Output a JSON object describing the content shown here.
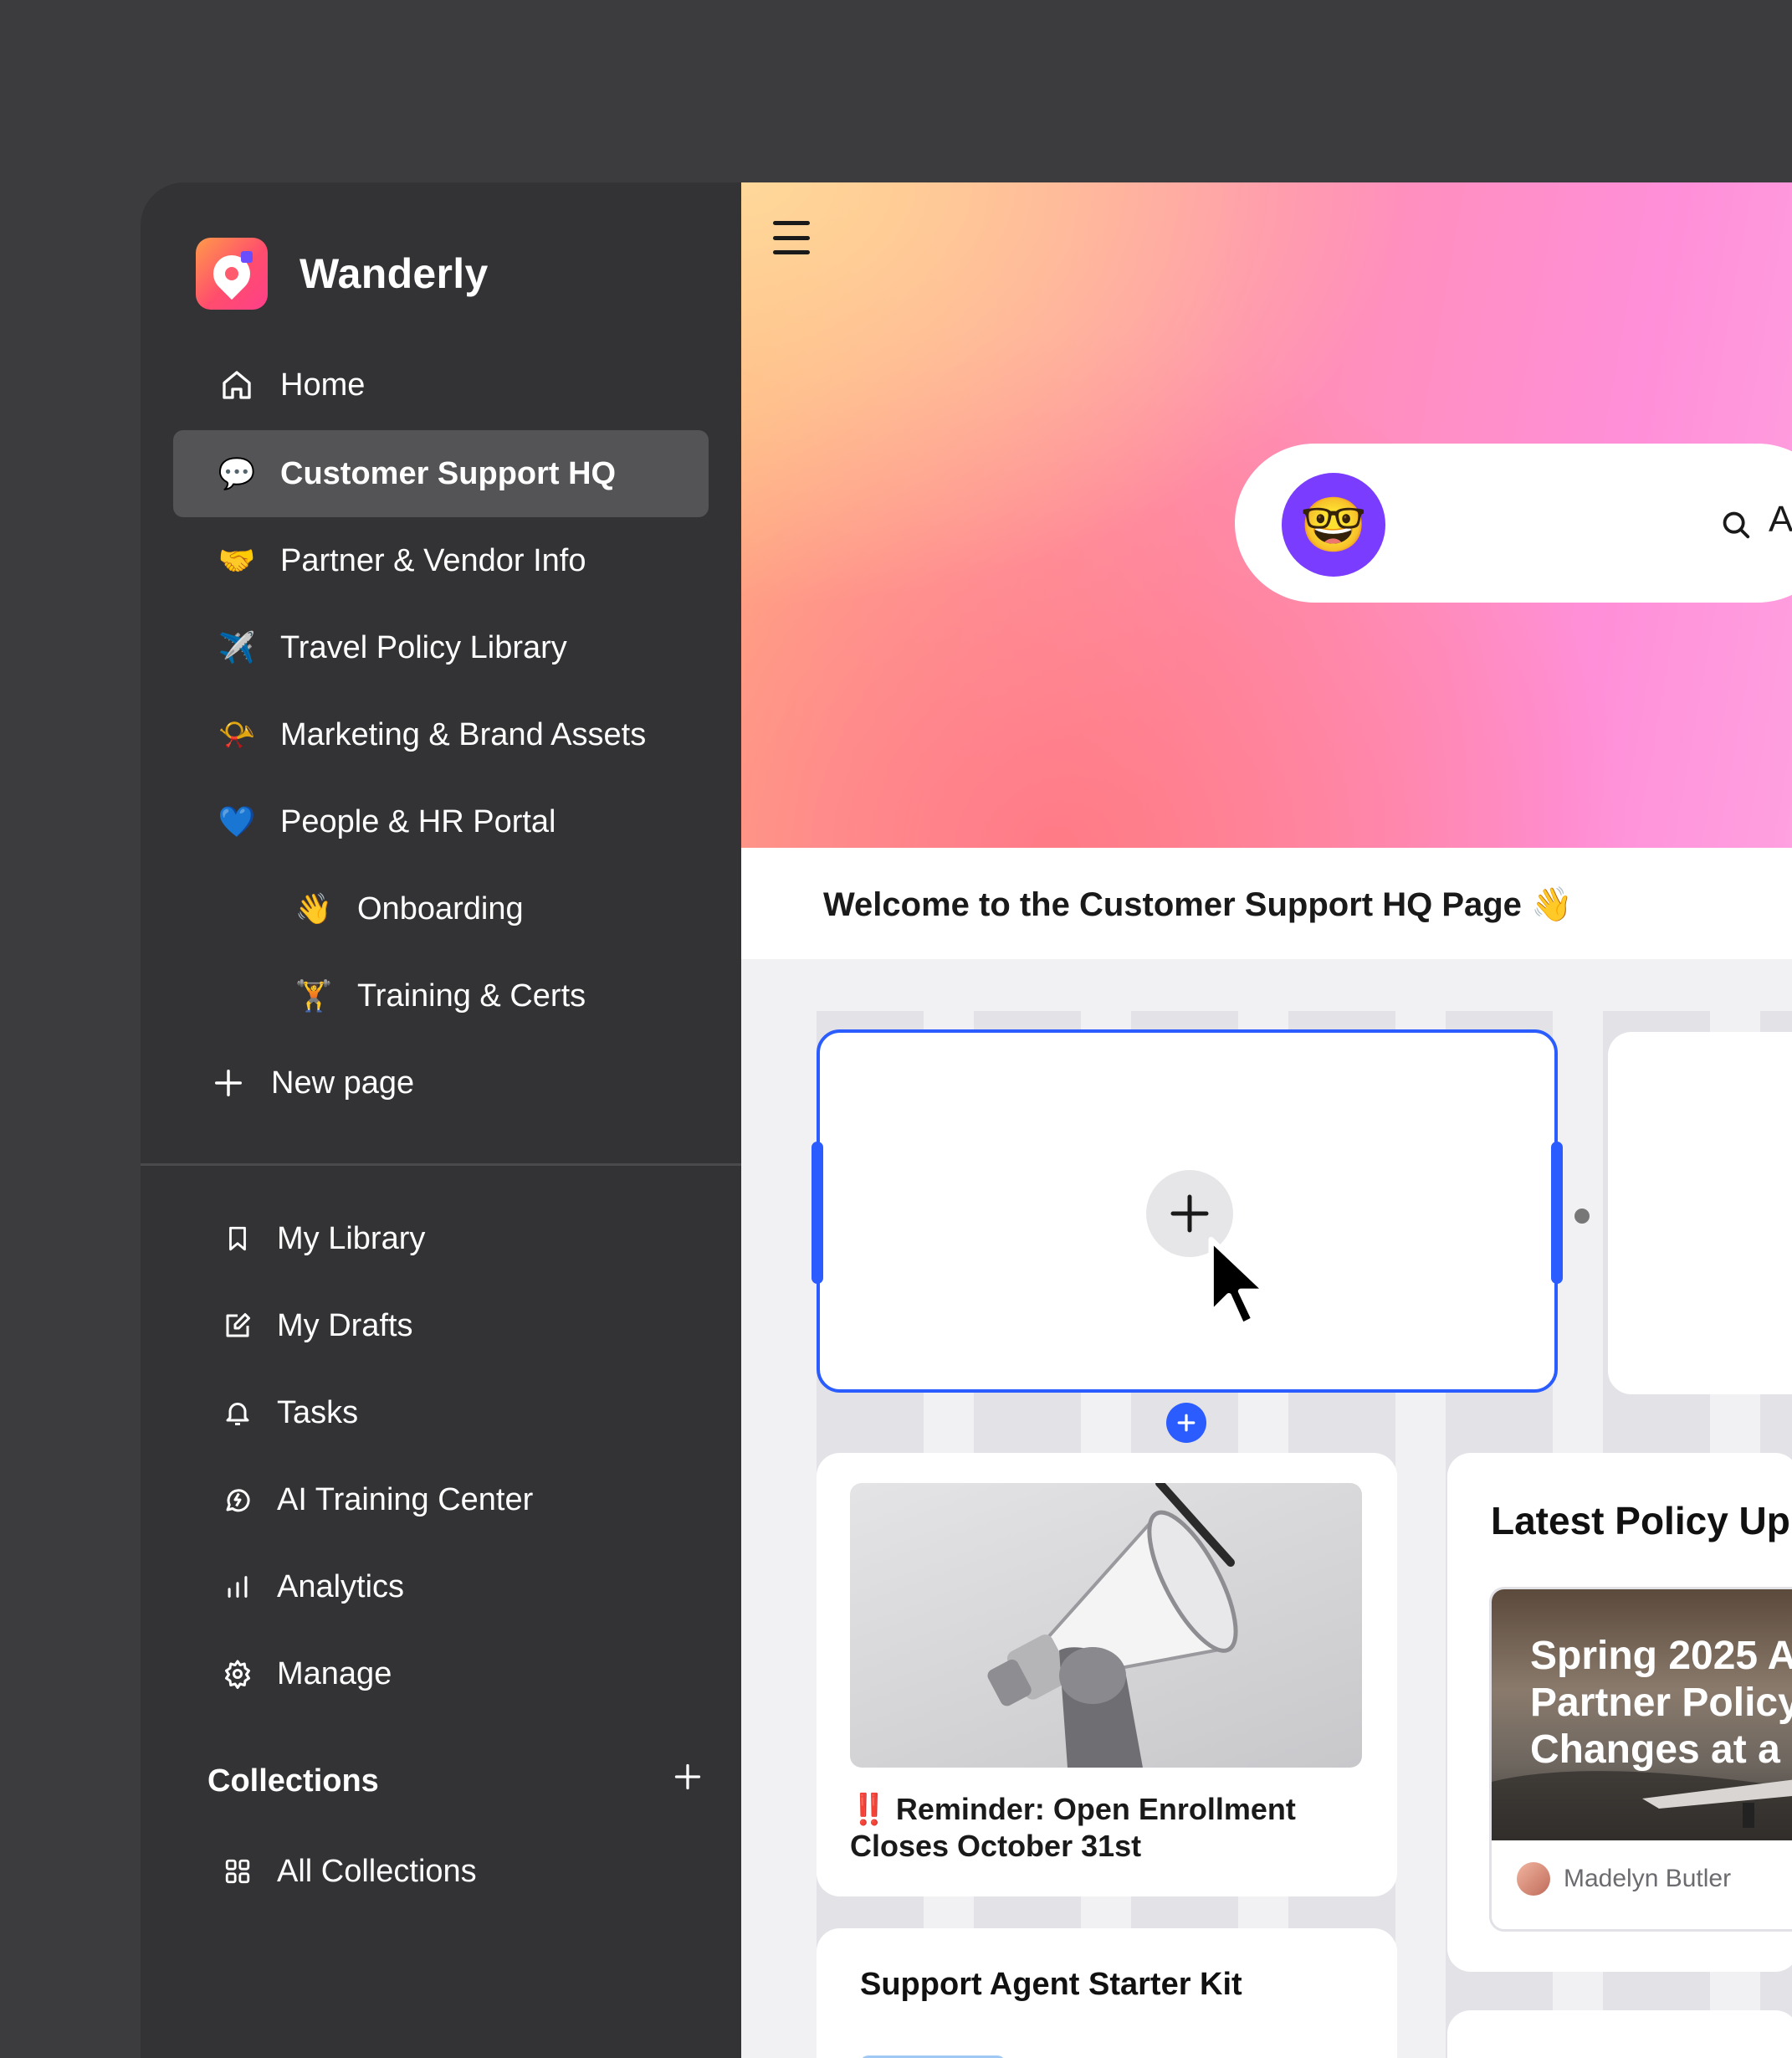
{
  "brand": {
    "name": "Wanderly"
  },
  "sidebar": {
    "items": [
      {
        "label": "Home",
        "icon": "home-icon"
      },
      {
        "label": "Customer Support HQ",
        "icon": "💬",
        "active": true
      },
      {
        "label": "Partner & Vendor Info",
        "icon": "🤝"
      },
      {
        "label": "Travel Policy Library",
        "icon": "✈️"
      },
      {
        "label": "Marketing & Brand Assets",
        "icon": "📯"
      },
      {
        "label": "People & HR Portal",
        "icon": "💙"
      },
      {
        "label": "Onboarding",
        "icon": "👋"
      },
      {
        "label": "Training & Certs",
        "icon": "🏋️"
      }
    ],
    "new_page": "New page",
    "lower": [
      {
        "label": "My Library",
        "icon": "bookmark-icon"
      },
      {
        "label": "My Drafts",
        "icon": "edit-icon"
      },
      {
        "label": "Tasks",
        "icon": "bell-icon"
      },
      {
        "label": "AI Training Center",
        "icon": "ai-icon"
      },
      {
        "label": "Analytics",
        "icon": "bar-chart-icon"
      },
      {
        "label": "Manage",
        "icon": "gear-icon"
      }
    ],
    "collections": {
      "title": "Collections",
      "all": "All Collections"
    }
  },
  "main": {
    "search": {
      "avatar": "🤓",
      "text": "A"
    },
    "welcome": "Welcome to the Customer Support HQ Page 👋",
    "reminder": {
      "bang": "‼️",
      "title": "Reminder: Open Enrollment Closes October 31st"
    },
    "policy": {
      "title": "Latest Policy Up",
      "image_text_1": "Spring 2025 A",
      "image_text_2": "Partner Policy",
      "image_text_3": "Changes at a G",
      "author": "Madelyn Butler"
    },
    "starter": {
      "title": "Support Agent Starter Kit"
    }
  },
  "colors": {
    "accent": "#2b5cff",
    "sidebar": "#333336",
    "active": "#545457"
  }
}
